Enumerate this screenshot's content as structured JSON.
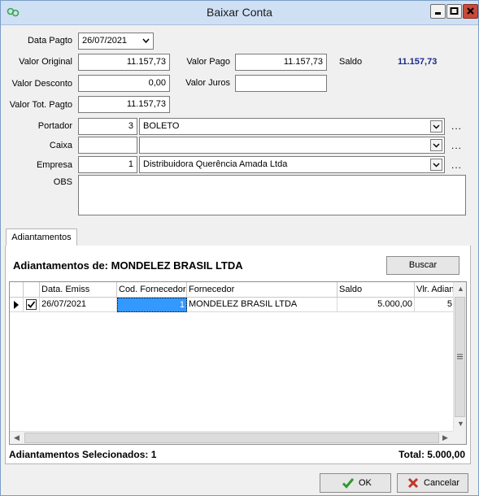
{
  "window": {
    "title": "Baixar Conta",
    "app_icon": "app-logo-icon"
  },
  "form": {
    "data_pagto": {
      "label": "Data Pagto",
      "value": "26/07/2021"
    },
    "valor_original": {
      "label": "Valor Original",
      "value": "11.157,73"
    },
    "valor_pago": {
      "label": "Valor Pago",
      "value": "11.157,73"
    },
    "saldo": {
      "label": "Saldo",
      "value": "11.157,73",
      "color": "#1b2a8c"
    },
    "valor_desconto": {
      "label": "Valor Desconto",
      "value": "0,00"
    },
    "valor_juros": {
      "label": "Valor Juros",
      "value": ""
    },
    "valor_tot_pagto": {
      "label": "Valor Tot. Pagto",
      "value": "11.157,73"
    },
    "portador": {
      "label": "Portador",
      "code": "3",
      "name": "BOLETO"
    },
    "caixa": {
      "label": "Caixa",
      "code": "",
      "name": ""
    },
    "empresa": {
      "label": "Empresa",
      "code": "1",
      "name": "Distribuidora Querência Amada Ltda"
    },
    "obs": {
      "label": "OBS",
      "value": ""
    },
    "lookup_dots": "..."
  },
  "tabs": [
    {
      "label": "Adiantamentos"
    }
  ],
  "adiantamentos": {
    "title": "Adiantamentos de: MONDELEZ BRASIL LTDA",
    "buscar_label": "Buscar",
    "columns": [
      "Data. Emiss",
      "Cod. Fornecedor",
      "Fornecedor",
      "Saldo",
      "Vlr. Adian"
    ],
    "rows": [
      {
        "checked": true,
        "data_emiss": "26/07/2021",
        "cod_fornecedor": "1",
        "fornecedor": "MONDELEZ BRASIL LTDA",
        "saldo": "5.000,00",
        "vlr_adian": "5"
      }
    ],
    "selecionados_label": "Adiantamentos Selecionados: 1",
    "total_label": "Total: 5.000,00"
  },
  "buttons": {
    "ok_label": "OK",
    "cancelar_label": "Cancelar"
  }
}
